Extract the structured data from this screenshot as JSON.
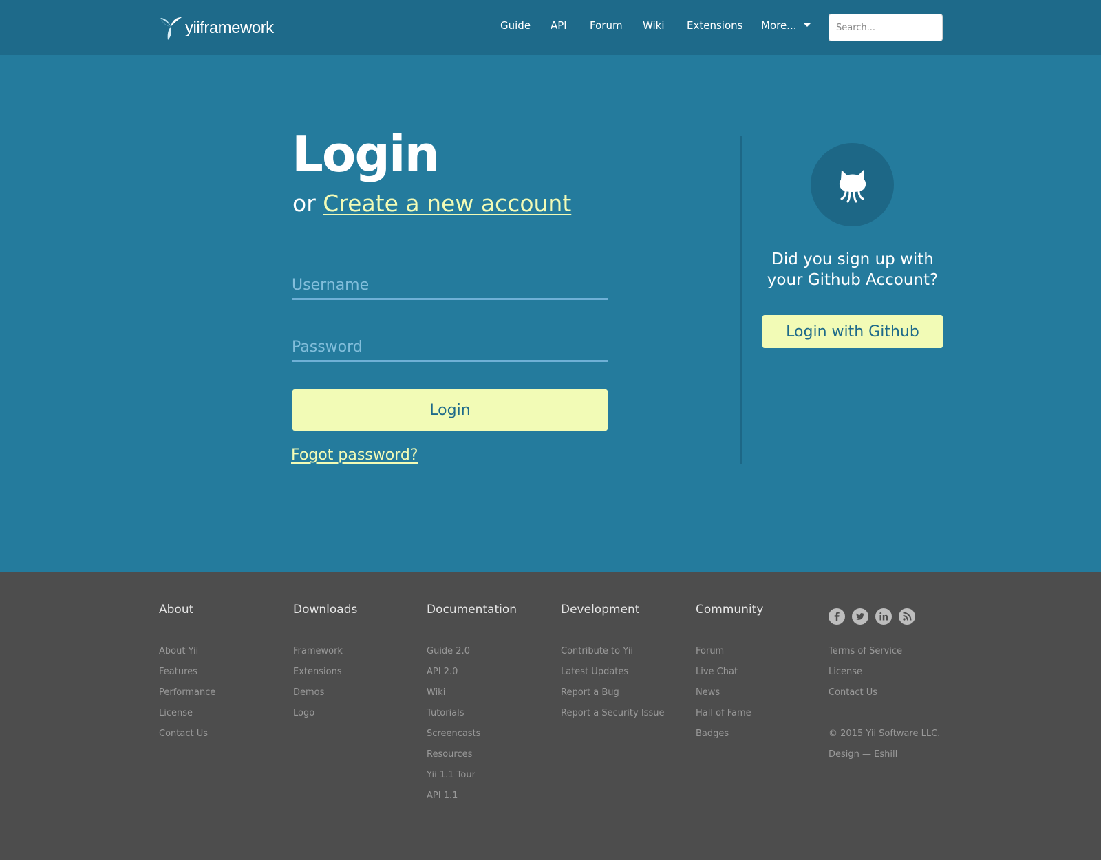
{
  "header": {
    "logo_text": "yiiframework",
    "nav": [
      "Guide",
      "API",
      "Forum",
      "Wiki",
      "Extensions",
      "More..."
    ],
    "search_placeholder": "Search..."
  },
  "login": {
    "title": "Login",
    "or_text": "or",
    "create_account_link": "Create a new account",
    "username_placeholder": "Username",
    "password_placeholder": "Password",
    "login_button": "Login",
    "forgot_link": "Fogot password?"
  },
  "github": {
    "question": "Did you sign up with your Github Account?",
    "button": "Login with Github"
  },
  "footer": {
    "columns": [
      {
        "heading": "About",
        "links": [
          "About Yii",
          "Features",
          "Performance",
          "License",
          "Contact Us"
        ]
      },
      {
        "heading": "Downloads",
        "links": [
          "Framework",
          "Extensions",
          "Demos",
          "Logo"
        ]
      },
      {
        "heading": "Documentation",
        "links": [
          "Guide 2.0",
          "API 2.0",
          "Wiki",
          "Tutorials",
          "Screencasts",
          "Resources",
          "Yii 1.1 Tour",
          "API 1.1"
        ]
      },
      {
        "heading": "Development",
        "links": [
          "Contribute to Yii",
          "Latest Updates",
          "Report a Bug",
          "Report a Security Issue"
        ]
      },
      {
        "heading": "Community",
        "links": [
          "Forum",
          "Live Chat",
          "News",
          "Hall of Fame",
          "Badges"
        ]
      }
    ],
    "legal_links": [
      "Terms of Service",
      "License",
      "Contact Us"
    ],
    "copyright": "© 2015 Yii Software LLC.",
    "design_credit": "Design — Eshill",
    "social_icons": [
      "facebook-icon",
      "twitter-icon",
      "linkedin-icon",
      "rss-icon"
    ]
  },
  "colors": {
    "header_bg": "#1e6a8a",
    "main_bg": "#247b9d",
    "accent": "#f2fbb6",
    "footer_bg": "#4d4d4d"
  }
}
